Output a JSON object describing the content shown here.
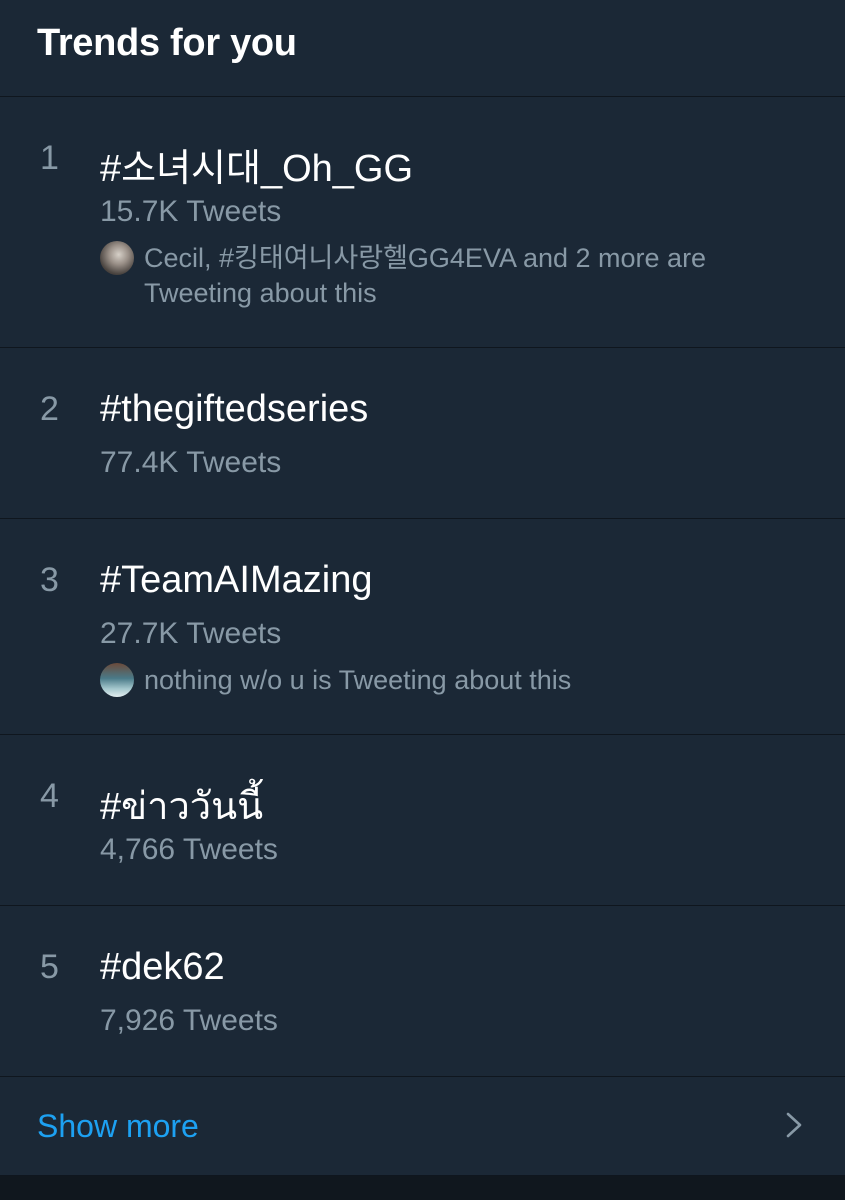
{
  "header": {
    "title": "Trends for you"
  },
  "trends": [
    {
      "rank": "1",
      "tag": "#소녀시대_Oh_GG",
      "count": "15.7K Tweets",
      "context": "Cecil, #킹태여니사랑헬GG4EVA and 2 more are Tweeting about this"
    },
    {
      "rank": "2",
      "tag": "#thegiftedseries",
      "count": "77.4K Tweets"
    },
    {
      "rank": "3",
      "tag": "#TeamAIMazing",
      "count": "27.7K Tweets",
      "context": "nothing w/o u is Tweeting about this"
    },
    {
      "rank": "4",
      "tag": "#ข่าววันนี้",
      "count": "4,766 Tweets"
    },
    {
      "rank": "5",
      "tag": "#dek62",
      "count": "7,926 Tweets"
    }
  ],
  "show_more": {
    "label": "Show more",
    "icon": "chevron-right-icon"
  },
  "colors": {
    "background": "#1b2836",
    "divider": "#0f161e",
    "primary_text": "#ffffff",
    "secondary_text": "#8899a6",
    "accent": "#1da1f2"
  }
}
